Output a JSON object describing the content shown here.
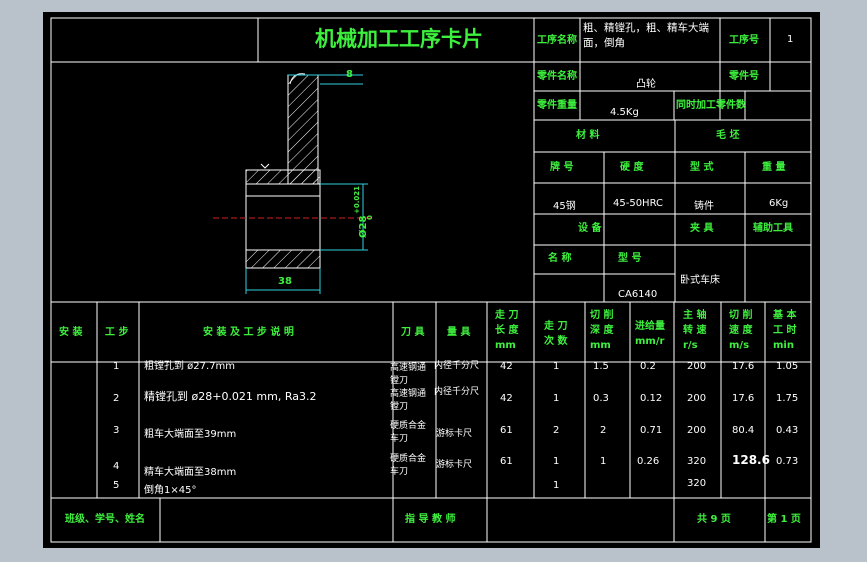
{
  "card": {
    "title": "机械加工工序卡片",
    "process_name_label": "工序名称",
    "process_name": "粗、精镗孔，粗、精车大端面，倒角",
    "process_no_label": "工序号",
    "process_no": "1",
    "part_name_label": "零件名称",
    "part_name": "凸轮",
    "part_no_label": "零件号",
    "part_no": "",
    "part_weight_label": "零件重量",
    "part_weight": "4.5Kg",
    "same_parts_label": "同时加工零件数",
    "same_parts": ""
  },
  "material": {
    "header": "材   料",
    "grade_label": "牌   号",
    "grade": "45钢",
    "hardness_label": "硬   度",
    "hardness": "45-50HRC"
  },
  "blank": {
    "header": "毛   坯",
    "type_label": "型   式",
    "type": "铸件",
    "weight_label": "重   量",
    "weight": "6Kg"
  },
  "equipment": {
    "header": "设   备",
    "name_label": "名   称",
    "name": "",
    "model_label": "型   号",
    "model": "CA6140",
    "fixture_label": "夹   具",
    "fixture": "卧式车床",
    "aux_label": "辅助工具",
    "aux": ""
  },
  "drawing": {
    "dim_top": "8",
    "dim_bottom": "38",
    "dim_bore": "Ø28",
    "tol_upper": "+0.021",
    "tol_lower": "0"
  },
  "table": {
    "headers": {
      "install": "安 装",
      "step": "工 步",
      "desc": "安 装 及 工 步 说 明",
      "tool": "刀 具",
      "gauge": "量 具",
      "cut_length": "走 刀\n长 度\nmm",
      "passes": "走 刀\n次 数",
      "depth": "切 削\n深 度\nmm",
      "feed": "进给量\nmm/r",
      "speed": "主 轴\n转 速\nr/s",
      "velocity": "切 削\n速 度\nm/s",
      "time": "基 本\n工 时\nmin"
    },
    "rows": [
      {
        "step": "1",
        "desc": "粗镗孔到 ø27.7mm",
        "tool": "高速钢通\n镗刀",
        "gauge": "内径千分尺",
        "length": "42",
        "passes": "1",
        "depth": "1.5",
        "feed": "0.2",
        "speed": "200",
        "vel": "17.6",
        "time": "1.05"
      },
      {
        "step": "2",
        "desc": "精镗孔到 ø28+0.021  mm, Ra3.2",
        "tool": "高速钢通\n镗刀",
        "gauge": "内径千分尺",
        "length": "42",
        "passes": "1",
        "depth": "0.3",
        "feed": "0.12",
        "speed": "200",
        "vel": "17.6",
        "time": "1.75"
      },
      {
        "step": "3",
        "desc": "粗车大端面至39mm",
        "tool": "硬质合金\n车刀",
        "gauge": "游标卡尺",
        "length": "61",
        "passes": "2",
        "depth": "2",
        "feed": "0.71",
        "speed": "200",
        "vel": "80.4",
        "time": "0.43"
      },
      {
        "step": "4",
        "desc": "精车大端面至38mm",
        "tool": "硬质合金\n车刀",
        "gauge": "游标卡尺",
        "length": "61",
        "passes": "1",
        "depth": "1",
        "feed": "0.26",
        "speed": "320",
        "vel": "128.6",
        "time": "0.73"
      },
      {
        "step": "5",
        "desc": "倒角1×45°",
        "tool": "",
        "gauge": "",
        "length": "",
        "passes": "1",
        "depth": "",
        "feed": "",
        "speed": "320",
        "vel": "",
        "time": ""
      }
    ]
  },
  "footer": {
    "class_label": "班级、学号、姓名",
    "class_value": "",
    "teacher_label": "指 导 教 师",
    "teacher_value": "",
    "total_pages": "共 9 页",
    "page": "第 1 页"
  },
  "colors": {
    "label_green": "#3ef03e",
    "line_white": "#ffffff",
    "centerline_red": "#d02020",
    "dim_cyan": "#30d0e0",
    "background": "#b9c1ca"
  }
}
